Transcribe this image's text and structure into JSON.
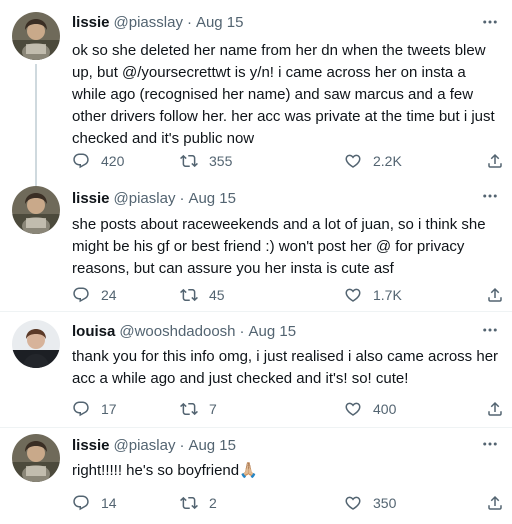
{
  "tweets": [
    {
      "name": "lissie",
      "handle": "@piasslay",
      "dot": "·",
      "date": "Aug 15",
      "text": "ok so she deleted her name from her dn when the tweets blew up, but @/yoursecrettwt is y/n! i came across her on insta a while ago (recognised her name) and saw marcus and a few other drivers follow her. her acc was private at the time but i just checked and it's public now",
      "replies": "420",
      "retweets": "355",
      "likes": "2.2K"
    },
    {
      "name": "lissie",
      "handle": "@piaslay",
      "dot": "·",
      "date": "Aug 15",
      "text": "she posts about raceweekends and a lot of juan, so i think she might be his gf or best friend :) won't post her @ for privacy reasons, but can assure you her insta is cute asf",
      "replies": "24",
      "retweets": "45",
      "likes": "1.7K"
    },
    {
      "name": "louisa",
      "handle": "@wooshdadoosh",
      "dot": "·",
      "date": "Aug 15",
      "text": "thank you for this info omg, i just realised i also came across her acc a while ago and just checked and it's! so! cute!",
      "replies": "17",
      "retweets": "7",
      "likes": "400"
    },
    {
      "name": "lissie",
      "handle": "@piaslay",
      "dot": "·",
      "date": "Aug 15",
      "text": "right!!!!! he's so boyfriend🙏🏼",
      "replies": "14",
      "retweets": "2",
      "likes": "350"
    }
  ],
  "icons": {
    "reply": "reply-icon",
    "retweet": "retweet-icon",
    "like": "heart-icon",
    "share": "share-icon",
    "more": "more-icon"
  },
  "colors": {
    "text": "#0f1419",
    "secondary": "#536471",
    "divider": "#eff3f4",
    "thread_line": "#cfd9de"
  }
}
